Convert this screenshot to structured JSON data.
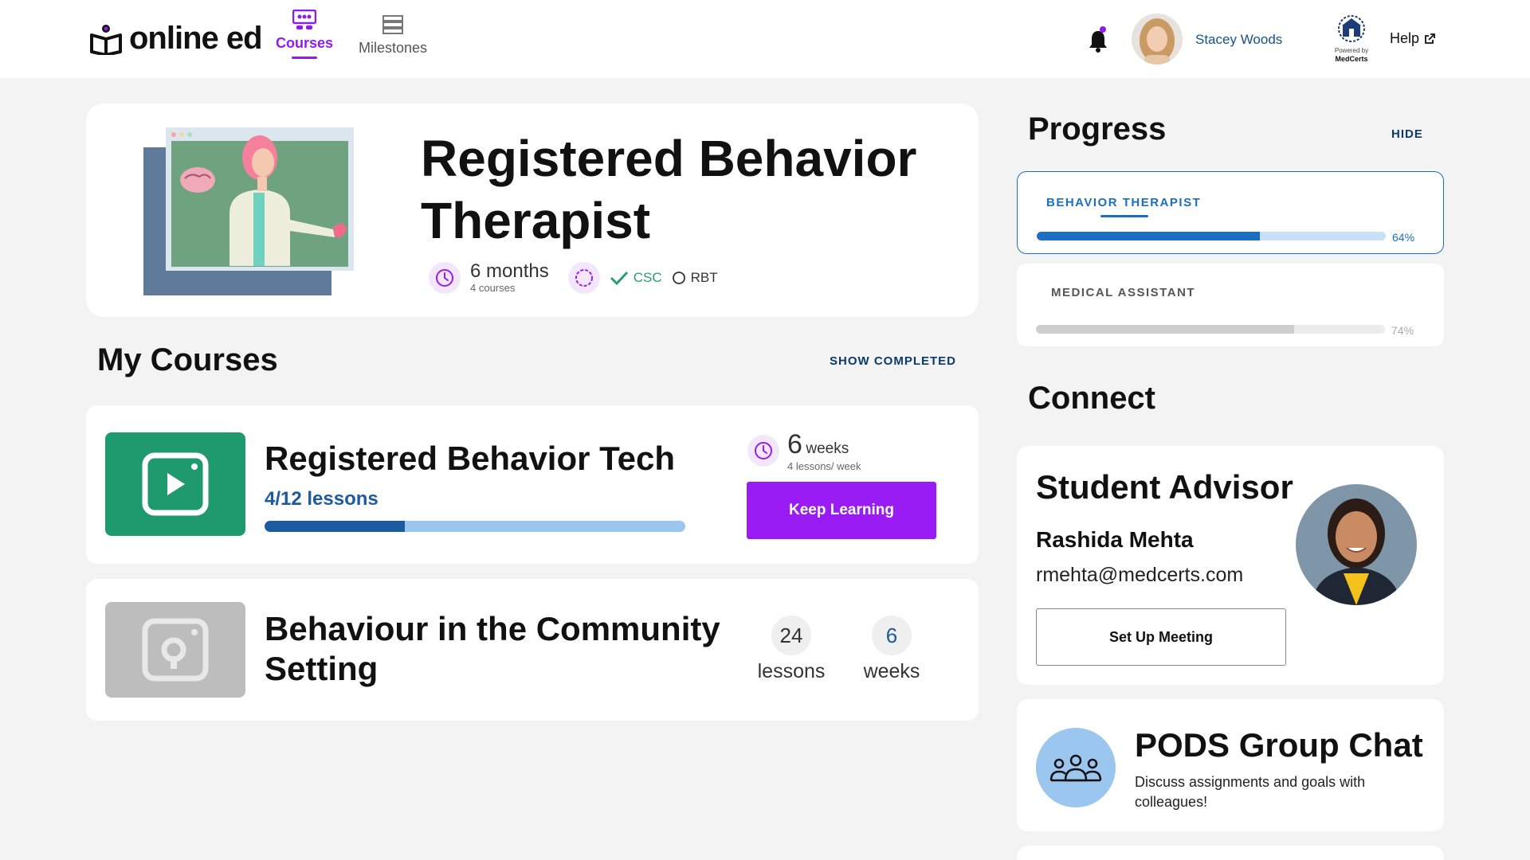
{
  "app": {
    "logo_text": "online ed"
  },
  "nav": {
    "tabs": [
      {
        "label": "Courses",
        "active": true
      },
      {
        "label": "Milestones",
        "active": false
      }
    ]
  },
  "user": {
    "name": "Stacey Woods"
  },
  "partner": {
    "powered_by": "Powered by",
    "brand": "MedCerts"
  },
  "help": {
    "label": "Help"
  },
  "program": {
    "title": "Registered Behavior Therapist",
    "duration": "6 months",
    "course_count": "4 courses",
    "certifications": [
      {
        "name": "CSC",
        "status": "completed"
      },
      {
        "name": "RBT",
        "status": "pending"
      }
    ]
  },
  "my_courses": {
    "title": "My Courses",
    "show_completed_label": "SHOW COMPLETED",
    "courses": [
      {
        "name": "Registered Behavior Tech",
        "lessons_progress": "4/12 lessons",
        "progress_fraction": 0.3333,
        "duration_number": "6",
        "duration_unit": "weeks",
        "pace": "4 lessons/ week",
        "button_label": "Keep Learning"
      },
      {
        "name": "Behaviour in the Community Setting",
        "lessons_count": "24",
        "lessons_word": "lessons",
        "weeks_count": "6",
        "weeks_word": "weeks"
      }
    ]
  },
  "progress": {
    "title": "Progress",
    "hide_label": "HIDE",
    "programs": [
      {
        "label": "BEHAVIOR THERAPIST",
        "percent_label": "64%",
        "value": 0.64,
        "selected": true
      },
      {
        "label": "MEDICAL ASSISTANT",
        "percent_label": "74%",
        "value": 0.74,
        "selected": false
      }
    ]
  },
  "connect": {
    "title": "Connect",
    "advisor": {
      "role": "Student Advisor",
      "name": "Rashida Mehta",
      "email": "rmehta@medcerts.com",
      "button_label": "Set Up Meeting"
    },
    "group_chat": {
      "title": "PODS Group Chat",
      "description": "Discuss assignments and goals with colleagues!"
    }
  },
  "colors": {
    "accent_purple": "#9a1cf4",
    "brand_blue": "#1c5ba0",
    "progress_blue": "#1c6ec2",
    "course_green": "#1f9a6f",
    "success_green": "#2a9d70"
  }
}
